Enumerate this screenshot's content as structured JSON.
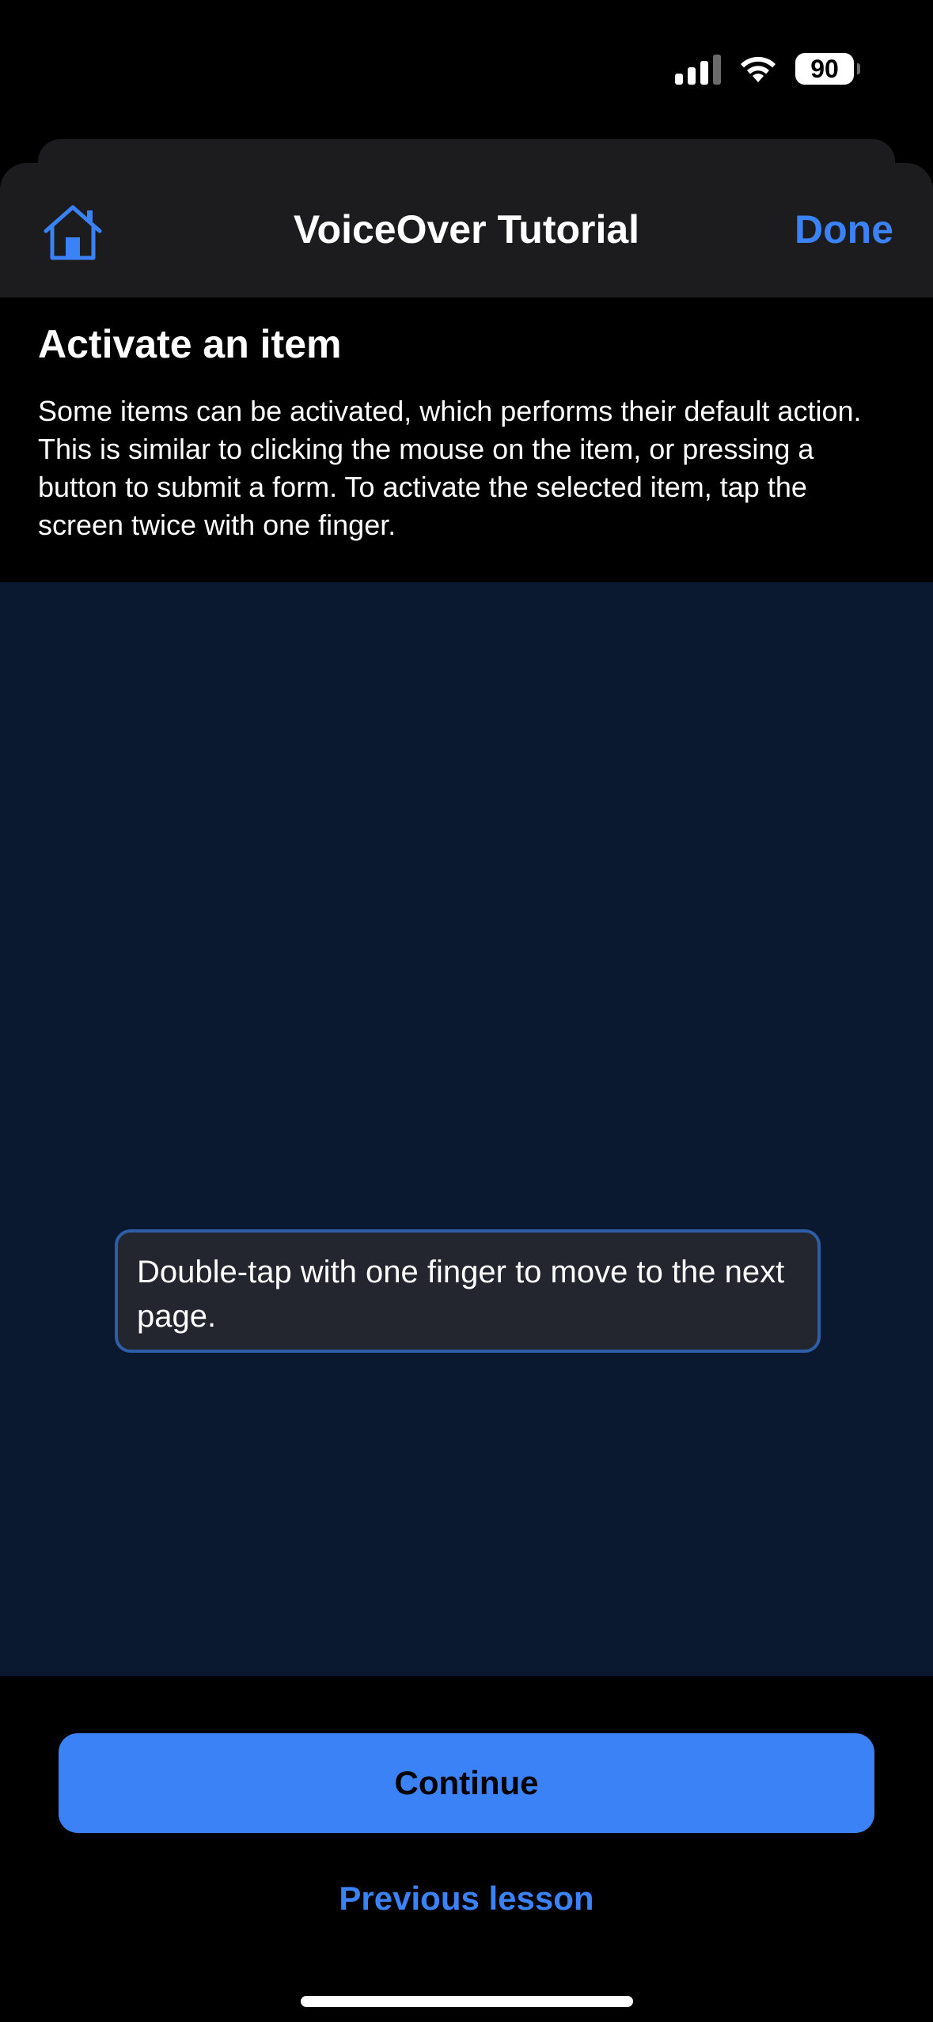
{
  "status_bar": {
    "battery_level": "90",
    "signal_bars_active": 3,
    "signal_bars_total": 4
  },
  "nav": {
    "title": "VoiceOver Tutorial",
    "done_label": "Done",
    "home_icon": "house-icon"
  },
  "lesson": {
    "title": "Activate an item",
    "body": "Some items can be activated, which performs their default action. This is similar to clicking the mouse on the item, or pressing a button to submit a form. To activate the selected item, tap the screen twice with one finger."
  },
  "practice": {
    "instruction": "Double-tap with one finger to move to the next page."
  },
  "actions": {
    "continue_label": "Continue",
    "previous_label": "Previous lesson"
  },
  "colors": {
    "accent": "#3b82f6",
    "practice_bg": "#0a1930",
    "nav_bg": "#1c1c1e"
  }
}
